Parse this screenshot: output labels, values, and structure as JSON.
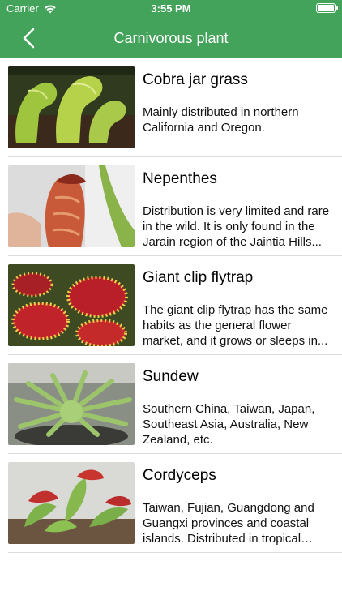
{
  "status": {
    "carrier": "Carrier",
    "time": "3:55 PM",
    "battery_level": 1.0
  },
  "nav": {
    "title": "Carnivorous plant",
    "back_icon": "chevron-left-icon"
  },
  "colors": {
    "accent": "#44a35a"
  },
  "plants": [
    {
      "name": "Cobra jar grass",
      "desc": "Mainly distributed in northern California and Oregon."
    },
    {
      "name": "Nepenthes",
      "desc": "Distribution is very limited and rare in the wild. It is only found in the Jarain region of the Jaintia Hills..."
    },
    {
      "name": "Giant clip flytrap",
      "desc": "The giant clip flytrap has the same habits as the general flower market, and it grows or sleeps in..."
    },
    {
      "name": "Sundew",
      "desc": "Southern China, Taiwan, Japan, Southeast Asia, Australia, New Zealand, etc."
    },
    {
      "name": "Cordyceps",
      "desc": "Taiwan, Fujian, Guangdong and Guangxi provinces and coastal islands. Distributed in tropical and..."
    }
  ]
}
